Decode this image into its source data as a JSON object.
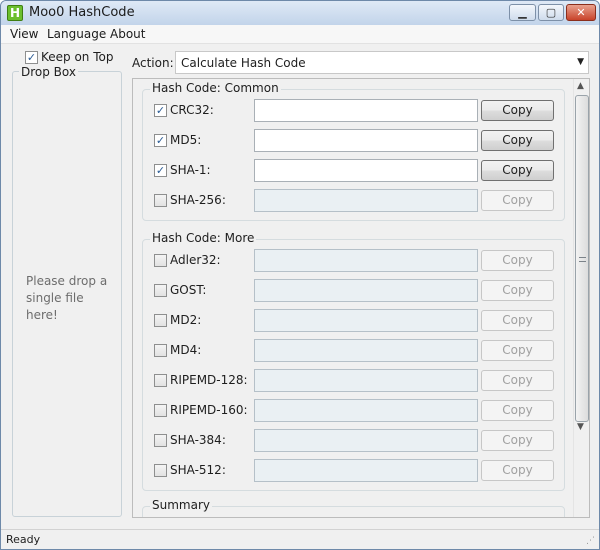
{
  "window": {
    "title": "Moo0 HashCode",
    "app_icon_letter": "H",
    "min_glyph": "▁",
    "max_glyph": "▢",
    "close_glyph": "✕"
  },
  "menu": [
    "View",
    "Language",
    "About"
  ],
  "keep_on_top": {
    "label": "Keep on Top",
    "checked": true
  },
  "dropbox": {
    "legend": "Drop Box",
    "hint": "Please drop a single file here!"
  },
  "action": {
    "label": "Action:",
    "value": "Calculate Hash Code",
    "arrow": "▼"
  },
  "groups": [
    {
      "legend": "Hash Code: Common",
      "rows": [
        {
          "label": "CRC32:",
          "checked": true,
          "copy": "Copy",
          "value": ""
        },
        {
          "label": "MD5:",
          "checked": true,
          "copy": "Copy",
          "value": ""
        },
        {
          "label": "SHA-1:",
          "checked": true,
          "copy": "Copy",
          "value": ""
        },
        {
          "label": "SHA-256:",
          "checked": false,
          "copy": "Copy",
          "value": ""
        }
      ]
    },
    {
      "legend": "Hash Code: More",
      "rows": [
        {
          "label": "Adler32:",
          "checked": false,
          "copy": "Copy",
          "value": ""
        },
        {
          "label": "GOST:",
          "checked": false,
          "copy": "Copy",
          "value": ""
        },
        {
          "label": "MD2:",
          "checked": false,
          "copy": "Copy",
          "value": ""
        },
        {
          "label": "MD4:",
          "checked": false,
          "copy": "Copy",
          "value": ""
        },
        {
          "label": "RIPEMD-128:",
          "checked": false,
          "copy": "Copy",
          "value": ""
        },
        {
          "label": "RIPEMD-160:",
          "checked": false,
          "copy": "Copy",
          "value": ""
        },
        {
          "label": "SHA-384:",
          "checked": false,
          "copy": "Copy",
          "value": ""
        },
        {
          "label": "SHA-512:",
          "checked": false,
          "copy": "Copy",
          "value": ""
        }
      ]
    },
    {
      "legend": "Summary",
      "rows": []
    }
  ],
  "scrollbar": {
    "up_arrow": "▲",
    "down_arrow": "▼"
  },
  "status": {
    "text": "Ready",
    "grip": "⋰"
  },
  "check_glyph": "✓"
}
